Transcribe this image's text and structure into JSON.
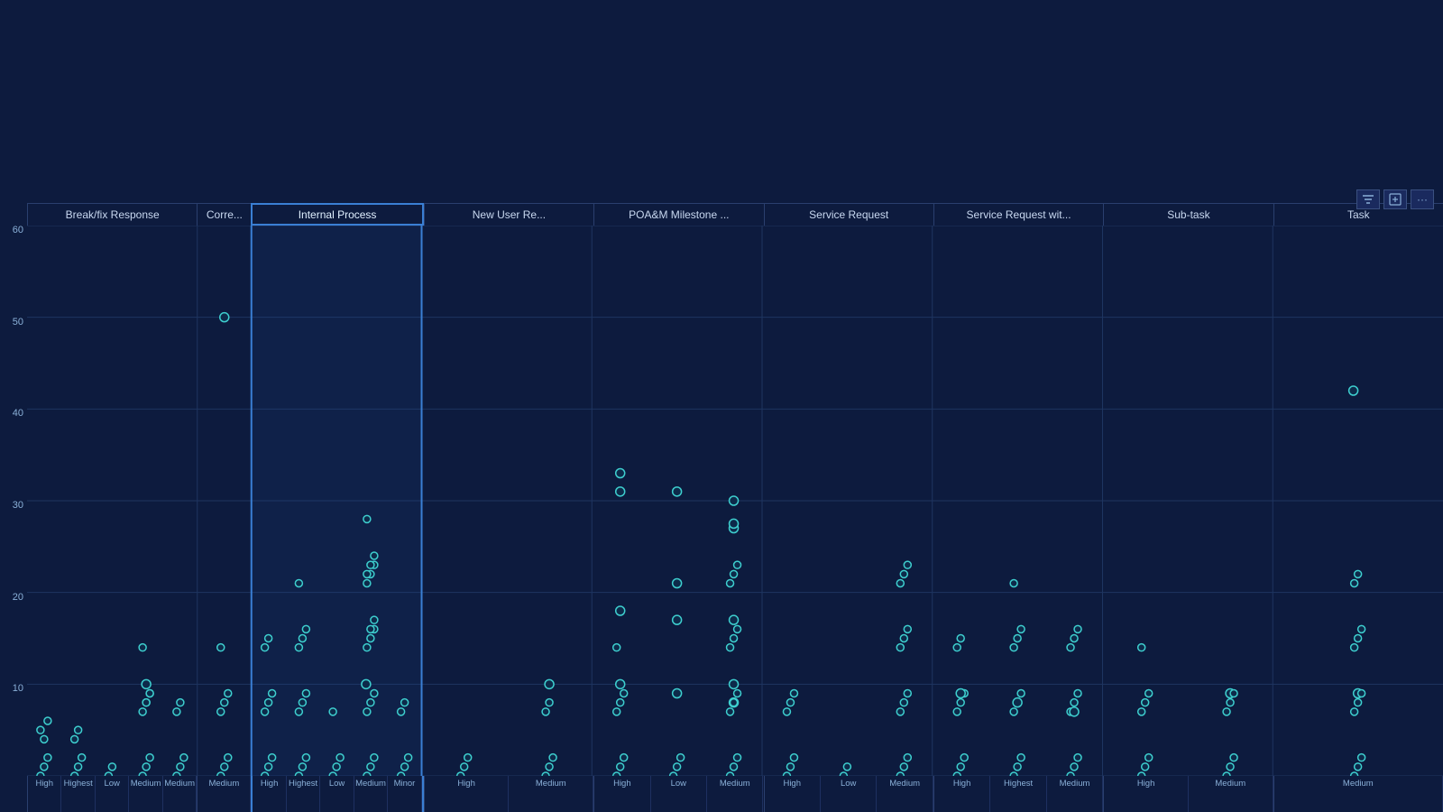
{
  "app": {
    "background": "#0d1b3e"
  },
  "toolbar": {
    "filter_icon": "⊞",
    "export_icon": "⊟",
    "more_icon": "···"
  },
  "chart": {
    "y_axis_labels": [
      "60",
      "50",
      "40",
      "30",
      "20",
      "10",
      ""
    ],
    "columns": [
      {
        "id": "break-fix",
        "label": "Break/fix Response",
        "selected": false,
        "x_labels": [
          "High",
          "Highest",
          "Low",
          "Medium",
          "Medium"
        ]
      },
      {
        "id": "corre",
        "label": "Corre...",
        "selected": false,
        "x_labels": [
          "Medium"
        ]
      },
      {
        "id": "internal-process",
        "label": "Internal Process",
        "selected": true,
        "x_labels": [
          "High",
          "Highest",
          "Low",
          "Medium",
          "Minor"
        ]
      },
      {
        "id": "new-user",
        "label": "New User Re...",
        "selected": false,
        "x_labels": [
          "High",
          "Medium"
        ]
      },
      {
        "id": "poam",
        "label": "POA&M Milestone ...",
        "selected": false,
        "x_labels": [
          "High",
          "Low",
          "Medium"
        ]
      },
      {
        "id": "service-request",
        "label": "Service Request",
        "selected": false,
        "x_labels": [
          "High",
          "Low",
          "Medium"
        ]
      },
      {
        "id": "service-request-wit",
        "label": "Service Request wit...",
        "selected": false,
        "x_labels": [
          "High",
          "Highest",
          "Medium"
        ]
      },
      {
        "id": "sub-task",
        "label": "Sub-task",
        "selected": false,
        "x_labels": [
          "High",
          "Medium"
        ]
      },
      {
        "id": "task",
        "label": "Task",
        "selected": false,
        "x_labels": [
          "Medium"
        ]
      }
    ]
  }
}
